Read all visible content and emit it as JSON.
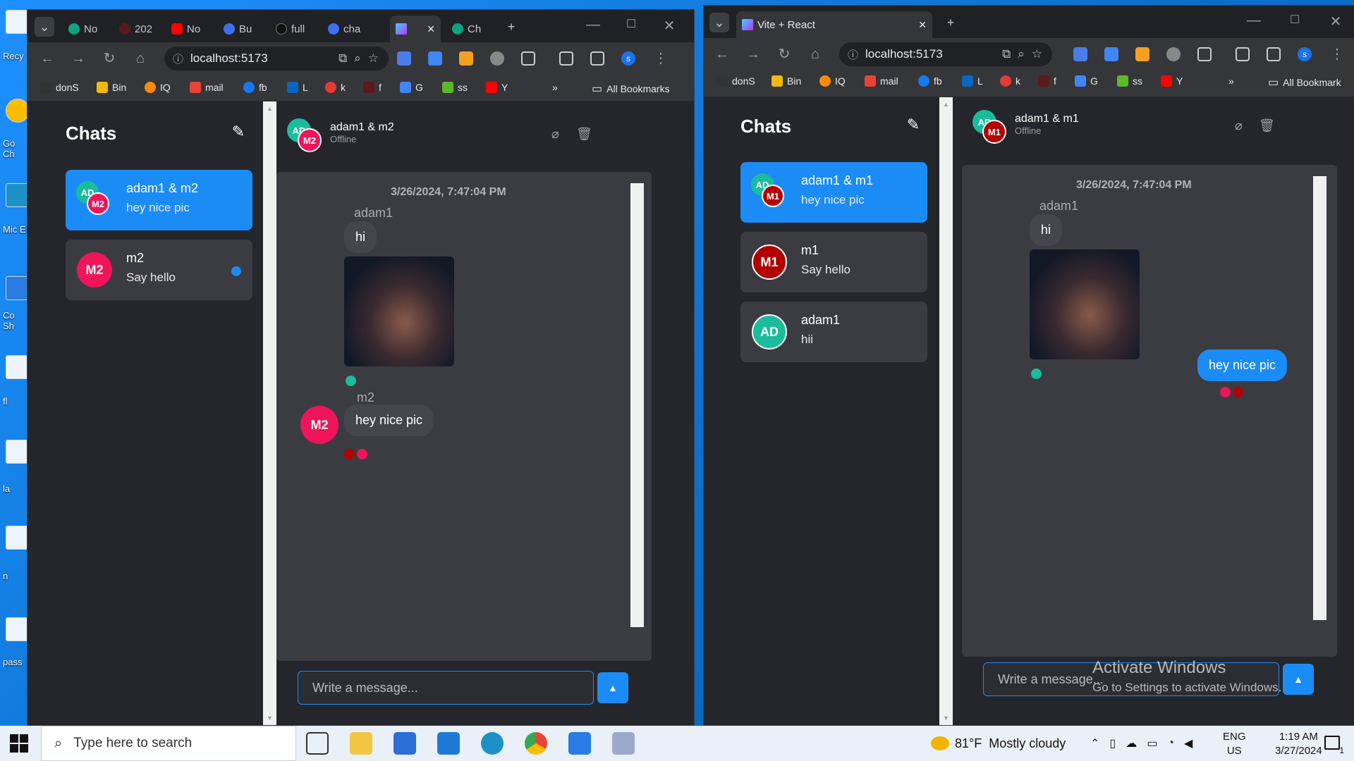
{
  "desktop": {
    "icons": [
      "Recy",
      "Go Ch",
      "Mic E",
      "Co Sh",
      "fl",
      "la",
      "n",
      "pass"
    ]
  },
  "left_window": {
    "tabs": [
      "No",
      "202",
      "No",
      "Bu",
      "full",
      "cha",
      "",
      "Ch"
    ],
    "url": "localhost:5173",
    "bookmarks": [
      "donS",
      "Bin",
      "IQ",
      "mail",
      "fb",
      "L",
      "k",
      "f",
      "G",
      "ss",
      "Y"
    ],
    "all_bookmarks": "All Bookmarks",
    "sidebar_title": "Chats",
    "conversations": [
      {
        "name": "adam1 & m2",
        "last": "hey nice pic",
        "avatar_a": "AD",
        "avatar_b": "M2",
        "selected": true
      },
      {
        "name": "m2",
        "last": "Say hello",
        "avatar": "M2",
        "unread": true
      }
    ],
    "header": {
      "name": "adam1 & m2",
      "status": "Offline",
      "avatar_a": "AD",
      "avatar_b": "M2"
    },
    "date": "3/26/2024, 7:47:04 PM",
    "messages": [
      {
        "sender": "adam1",
        "text": "hi",
        "image": true
      },
      {
        "sender": "m2",
        "text": "hey nice pic",
        "avatar": "M2"
      }
    ],
    "input_placeholder": "Write a message..."
  },
  "right_window": {
    "tab_title": "Vite + React",
    "url": "localhost:5173",
    "bookmarks": [
      "donS",
      "Bin",
      "IQ",
      "mail",
      "fb",
      "L",
      "k",
      "f",
      "G",
      "ss",
      "Y"
    ],
    "all_bookmarks": "All Bookmark",
    "sidebar_title": "Chats",
    "conversations": [
      {
        "name": "adam1 & m1",
        "last": "hey nice pic",
        "avatar_a": "AD",
        "avatar_b": "M1",
        "selected": true
      },
      {
        "name": "m1",
        "last": "Say hello",
        "avatar": "M1"
      },
      {
        "name": "adam1",
        "last": "hii",
        "avatar": "AD"
      }
    ],
    "header": {
      "name": "adam1 & m1",
      "status": "Offline",
      "avatar_a": "AD",
      "avatar_b": "M1"
    },
    "date": "3/26/2024, 7:47:04 PM",
    "messages": [
      {
        "sender": "adam1",
        "text": "hi",
        "image": true
      },
      {
        "text": "hey nice pic",
        "mine": true
      }
    ],
    "input_placeholder": "Write a message...",
    "watermark_title": "Activate Windows",
    "watermark_sub": "Go to Settings to activate Windows."
  },
  "taskbar": {
    "search_placeholder": "Type here to search",
    "weather": "81°F  Mostly cloudy",
    "lang_top": "ENG",
    "lang_bottom": "US",
    "time": "1:19 AM",
    "date": "3/27/2024",
    "notif_count": "1"
  },
  "colors": {
    "accent": "#1b8cf6",
    "ad": "#1abc9c",
    "m2": "#f0145a",
    "m1": "#b30000",
    "panel": "#25262b"
  }
}
